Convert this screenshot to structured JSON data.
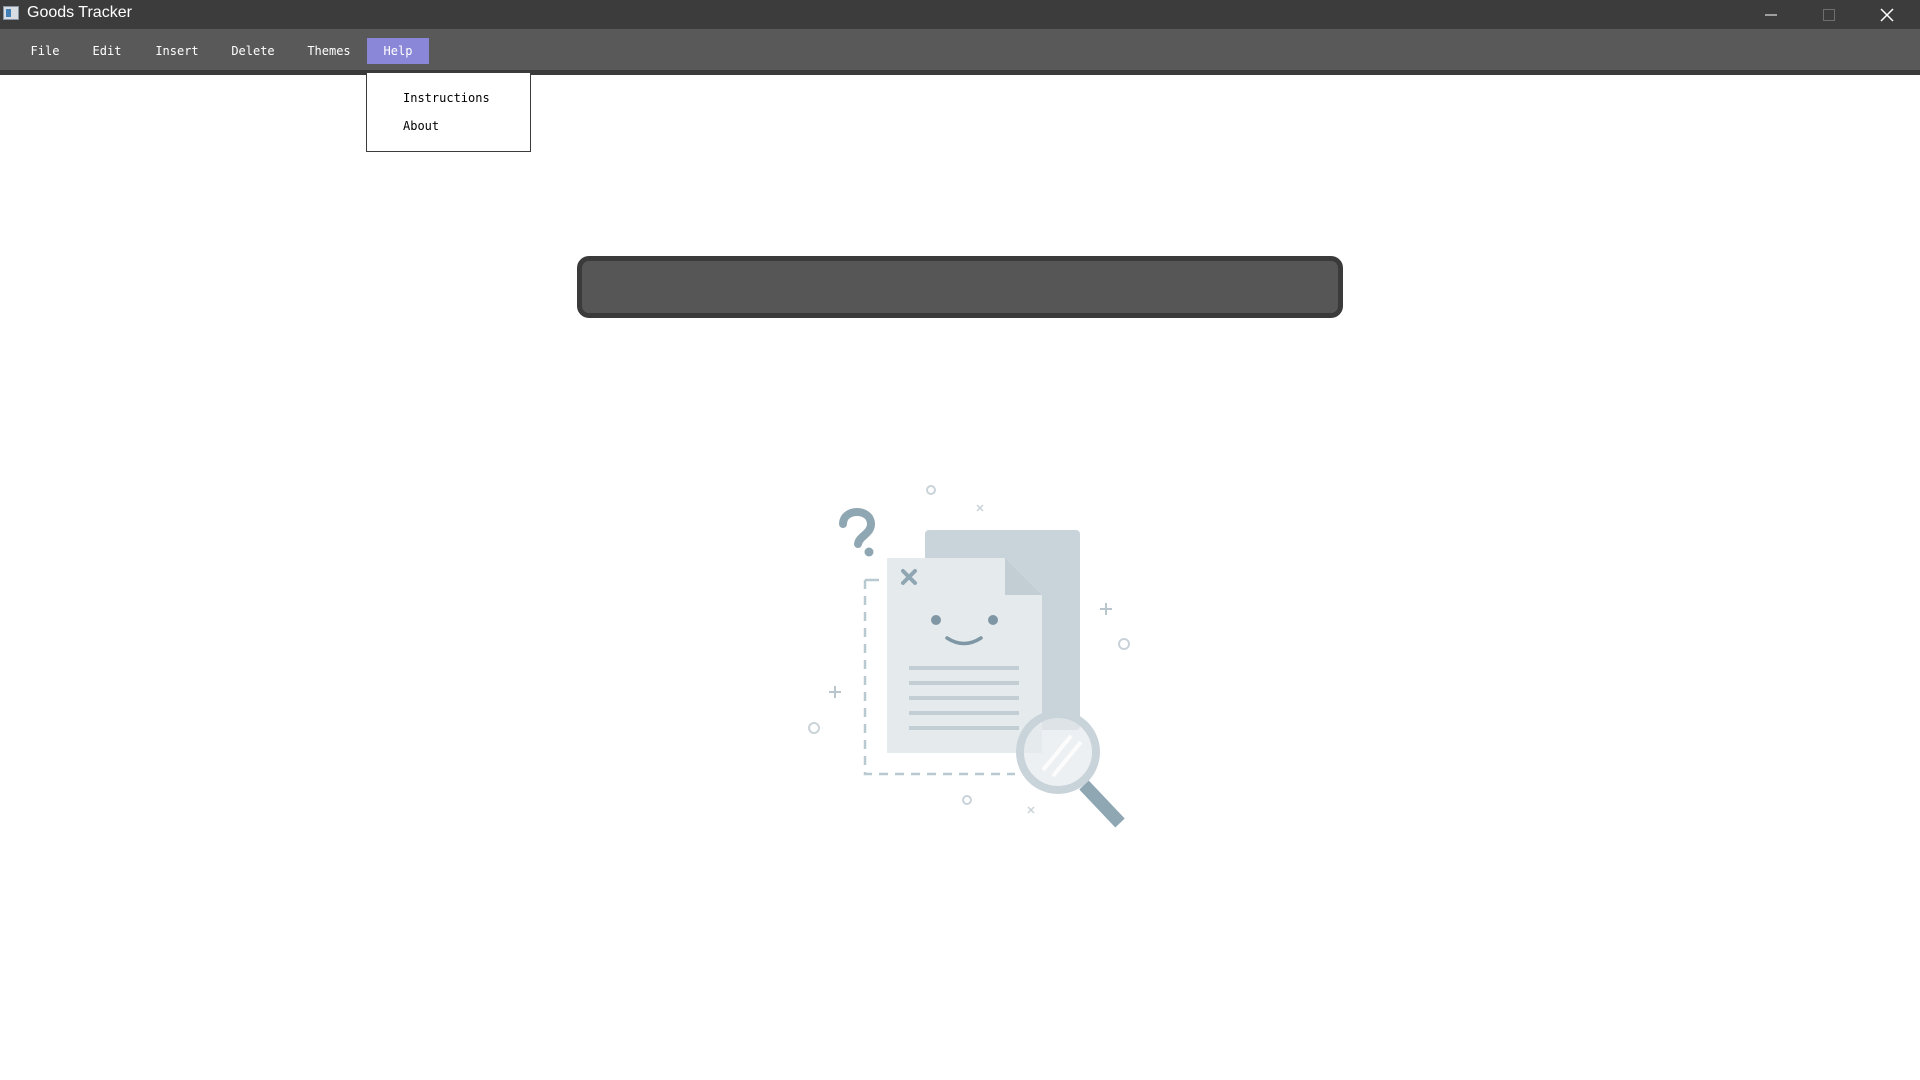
{
  "window": {
    "title": "Goods Tracker",
    "controls": [
      "minimize-icon",
      "maximize-icon",
      "close-icon"
    ]
  },
  "menu": {
    "items": [
      {
        "label": "File"
      },
      {
        "label": "Edit"
      },
      {
        "label": "Insert"
      },
      {
        "label": "Delete"
      },
      {
        "label": "Themes"
      },
      {
        "label": "Help",
        "active": true
      }
    ],
    "help_dropdown": {
      "items": [
        {
          "label": "Instructions"
        },
        {
          "label": "About"
        }
      ]
    }
  },
  "search": {
    "value": "",
    "placeholder": ""
  },
  "empty_state": {
    "icon": "no-results-document-magnifier-icon"
  },
  "colors": {
    "titlebar": "#3c3c3c",
    "menubar": "#595959",
    "menu_active": "#8b87d8",
    "searchbar_fill": "#565656",
    "searchbar_border": "#3a3a3a",
    "illustration_accent": "#8fa6b3"
  }
}
